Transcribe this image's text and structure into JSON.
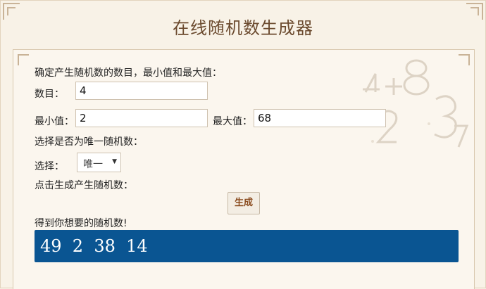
{
  "page": {
    "title": "在线随机数生成器"
  },
  "form": {
    "intro": "确定产生随机数的数目，最小值和最大值：",
    "count_label": "数目：",
    "count_value": "4",
    "min_label": "最小值：",
    "min_value": "2",
    "max_label": "最大值：",
    "max_value": "68",
    "unique_prompt": "选择是否为唯一随机数：",
    "select_label": "选择：",
    "select_value": "唯一",
    "generate_prompt": "点击生成产生随机数：",
    "generate_button": "生成",
    "result_label": "得到你想要的随机数!",
    "result_value": "49  2  38  14"
  },
  "colors": {
    "background": "#f7f0e4",
    "title": "#6b4a2e",
    "result_bg": "#0a5592",
    "button_text": "#8a4b1e"
  },
  "icons": {
    "select_arrow": "triangle-down",
    "decoration": "numbers-watermark"
  }
}
